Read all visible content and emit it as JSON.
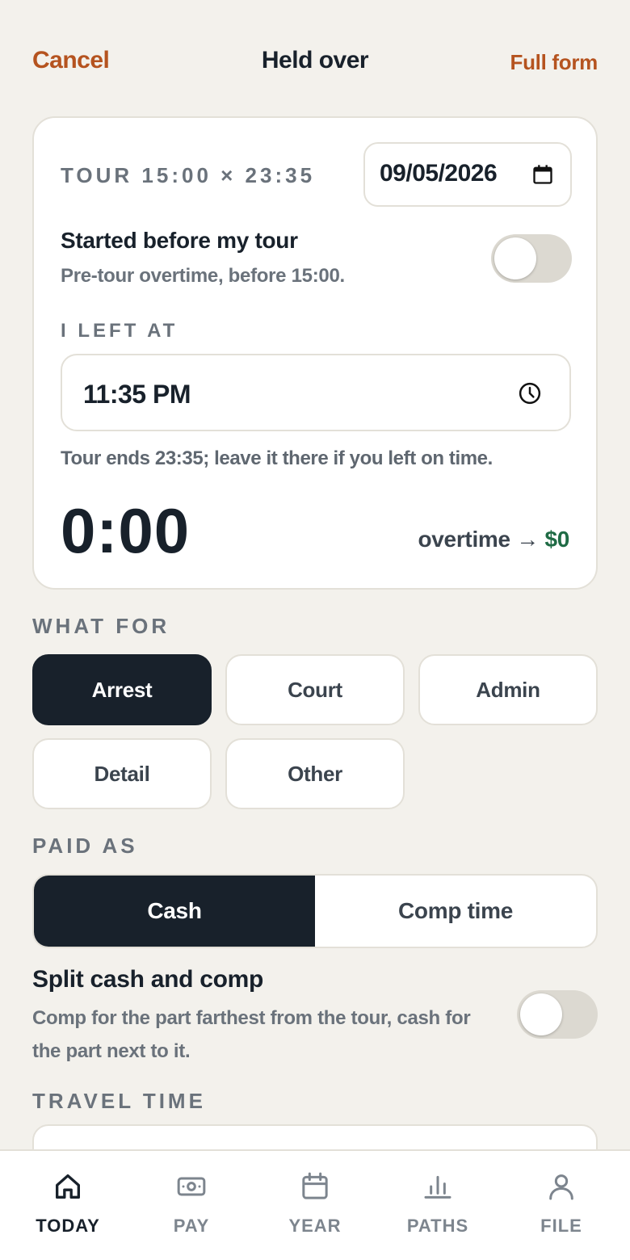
{
  "header": {
    "cancel_label": "Cancel",
    "title": "Held over",
    "full_form_label": "Full form"
  },
  "card": {
    "tour_label": "TOUR 15:00 × 23:35",
    "date_value": "09/05/2026",
    "started_before_title": "Started before my tour",
    "started_before_sub": "Pre-tour overtime, before 15:00.",
    "started_before_on": false,
    "left_at_label": "I LEFT AT",
    "left_at_value": "11:35 PM",
    "hint": "Tour ends 23:35; leave it there if you left on time.",
    "overtime_duration": "0:00",
    "overtime_prefix": "overtime →",
    "overtime_amount": "$0"
  },
  "what_for": {
    "label": "WHAT FOR",
    "options": [
      "Arrest",
      "Court",
      "Admin",
      "Detail",
      "Other"
    ],
    "selected": "Arrest"
  },
  "paid_as": {
    "label": "PAID AS",
    "options": [
      "Cash",
      "Comp time"
    ],
    "selected": "Cash"
  },
  "split": {
    "title": "Split cash and comp",
    "sub": "Comp for the part farthest from the tour, cash for the part next to it.",
    "on": false
  },
  "travel": {
    "label": "TRAVEL TIME"
  },
  "nav": {
    "items": [
      {
        "label": "TODAY",
        "icon": "home-icon",
        "active": true
      },
      {
        "label": "PAY",
        "icon": "cash-icon",
        "active": false
      },
      {
        "label": "YEAR",
        "icon": "calendar-icon",
        "active": false
      },
      {
        "label": "PATHS",
        "icon": "bar-chart-icon",
        "active": false
      },
      {
        "label": "FILE",
        "icon": "person-icon",
        "active": false
      }
    ]
  },
  "colors": {
    "accent": "#b5531f",
    "dark": "#18212b",
    "money": "#1f6b45",
    "background": "#f3f1ec"
  }
}
